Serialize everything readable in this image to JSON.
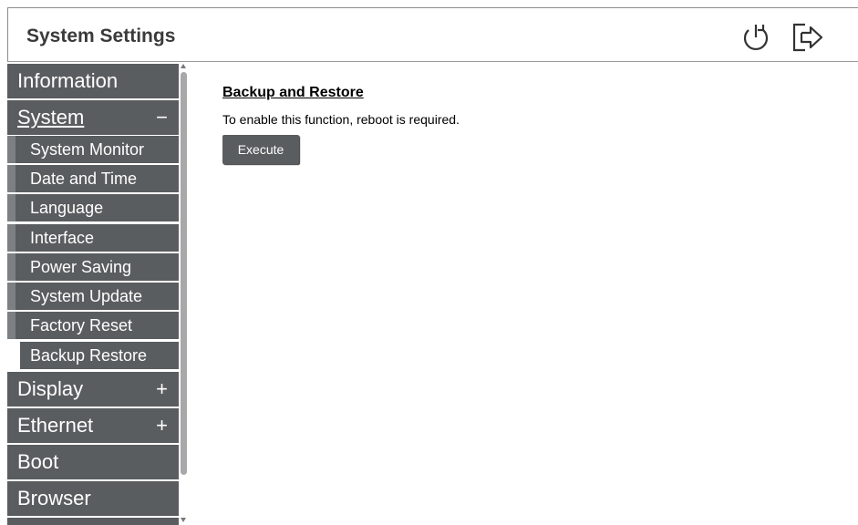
{
  "header": {
    "title": "System Settings",
    "power_icon": "power-restart-icon",
    "logout_icon": "logout-icon"
  },
  "sidebar": {
    "items": [
      {
        "label": "Information"
      },
      {
        "label": "System",
        "sign": "−"
      },
      {
        "label": "Display",
        "sign": "+"
      },
      {
        "label": "Ethernet",
        "sign": "+"
      },
      {
        "label": "Boot"
      },
      {
        "label": "Browser"
      }
    ],
    "system_subitems": [
      {
        "label": "System Monitor"
      },
      {
        "label": "Date and Time"
      },
      {
        "label": "Language"
      },
      {
        "label": "Interface"
      },
      {
        "label": "Power Saving"
      },
      {
        "label": "System Update"
      },
      {
        "label": "Factory Reset"
      },
      {
        "label": "Backup Restore",
        "active": true
      }
    ]
  },
  "main": {
    "section_title": "Backup and Restore",
    "description": "To enable this function, reboot is required.",
    "execute_label": "Execute"
  },
  "colors": {
    "nav_bg": "#5a5d5f",
    "sub_bar": "#7d8082",
    "active_bar": "#ffffff",
    "text_on_nav": "#ffffff"
  }
}
